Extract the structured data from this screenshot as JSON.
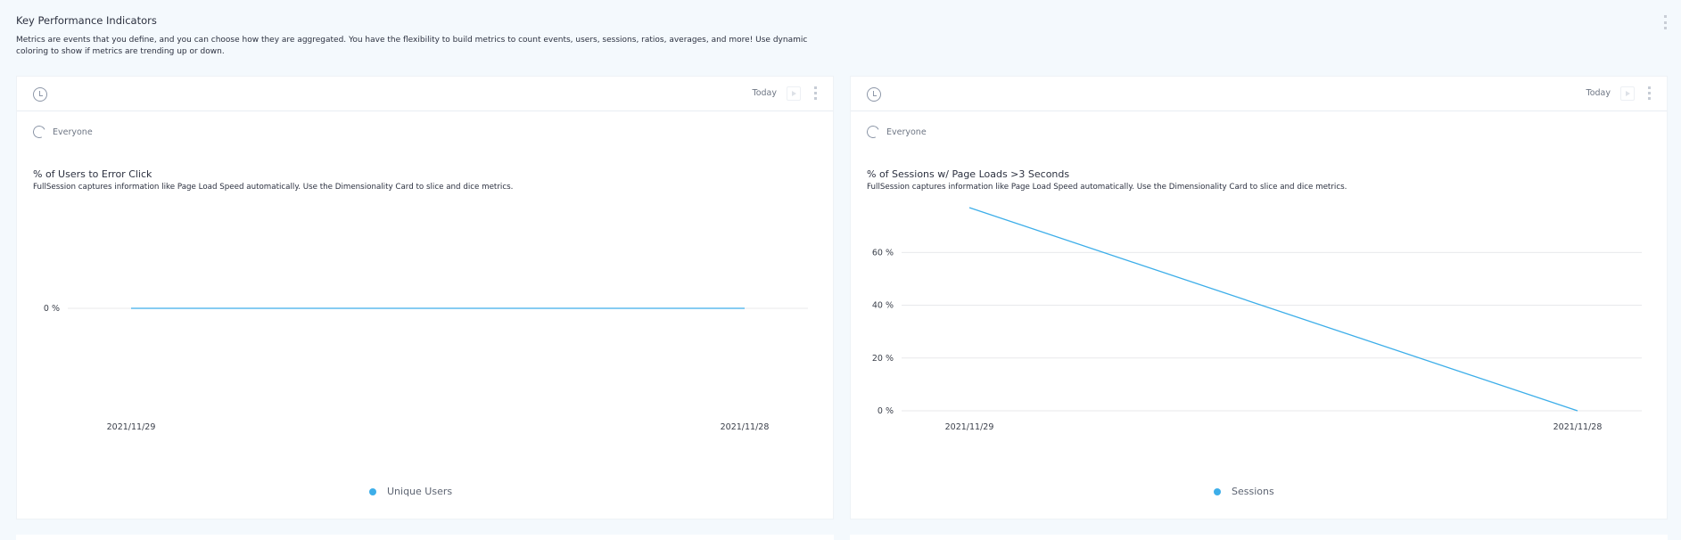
{
  "page": {
    "title": "Key Performance Indicators",
    "description": "Metrics are events that you define, and you can choose how they are aggregated. You have the flexibility to build metrics to count events, users, sessions, ratios, averages, and more! Use dynamic coloring to show if metrics are trending up or down.",
    "menu_icon": "kebab-menu-icon"
  },
  "cards": [
    {
      "time_range": "Today",
      "segment": "Everyone",
      "title": "% of Users to Error Click",
      "description": "FullSession captures information like Page Load Speed automatically. Use the Dimensionality Card to slice and dice metrics.",
      "legend": "Unique Users"
    },
    {
      "time_range": "Today",
      "segment": "Everyone",
      "title": "% of Sessions w/ Page Loads >3 Seconds",
      "description": "FullSession captures information like Page Load Speed automatically. Use the Dimensionality Card to slice and dice metrics.",
      "legend": "Sessions"
    }
  ],
  "colors": {
    "series": "#3daee9",
    "grid": "#e8e9eb"
  },
  "chart_data": [
    {
      "type": "line",
      "title": "% of Users to Error Click",
      "x": [
        "2021/11/29",
        "2021/11/28"
      ],
      "series": [
        {
          "name": "Unique Users",
          "values": [
            0,
            0
          ]
        }
      ],
      "yticks": [
        "0 %"
      ],
      "ytick_values": [
        0
      ],
      "ylim": [
        -1,
        1
      ],
      "grid": true,
      "legend": "bottom-center"
    },
    {
      "type": "line",
      "title": "% of Sessions w/ Page Loads >3 Seconds",
      "x": [
        "2021/11/29",
        "2021/11/28"
      ],
      "series": [
        {
          "name": "Sessions",
          "values": [
            77,
            0
          ]
        }
      ],
      "yticks": [
        "0 %",
        "20 %",
        "40 %",
        "60 %"
      ],
      "ytick_values": [
        0,
        20,
        40,
        60
      ],
      "ylim": [
        0,
        77
      ],
      "grid": true,
      "legend": "bottom-center"
    }
  ]
}
